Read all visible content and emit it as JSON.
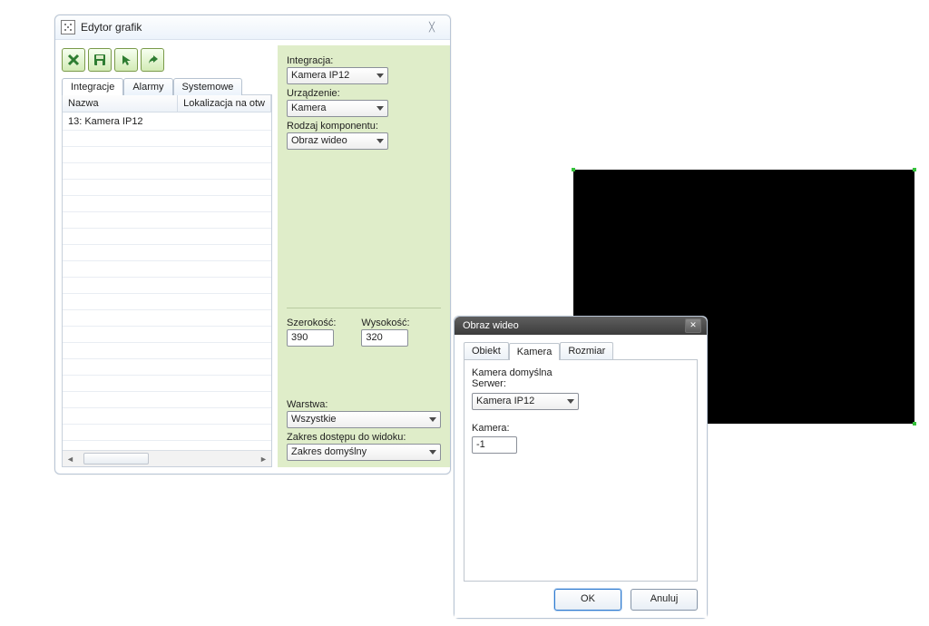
{
  "editor": {
    "title": "Edytor grafik",
    "toolbar": {
      "delete_tip": "X",
      "save_tip": "💾",
      "pointer_tip": "↖",
      "share_tip": "↪"
    },
    "tabs": [
      "Integracje",
      "Alarmy",
      "Systemowe"
    ],
    "active_tab_index": 0,
    "table": {
      "headers": [
        "Nazwa",
        "Lokalizacja na otw"
      ],
      "rows": [
        {
          "name": "13: Kamera IP12",
          "loc": ""
        }
      ]
    },
    "props": {
      "integracja_label": "Integracja:",
      "integracja": "Kamera IP12",
      "urzadzenie_label": "Urządzenie:",
      "urzadzenie": "Kamera",
      "rodzaj_label": "Rodzaj komponentu:",
      "rodzaj": "Obraz wideo",
      "szer_label": "Szerokość:",
      "szer": "390",
      "wys_label": "Wysokość:",
      "wys": "320",
      "warstwa_label": "Warstwa:",
      "warstwa": "Wszystkie",
      "zakres_label": "Zakres dostępu do widoku:",
      "zakres": "Zakres domyślny"
    }
  },
  "dialog": {
    "title": "Obraz wideo",
    "tabs": [
      "Obiekt",
      "Kamera",
      "Rozmiar"
    ],
    "active_tab_index": 1,
    "kamera_domyslna_label": "Kamera domyślna",
    "serwer_label": "Serwer:",
    "serwer": "Kamera IP12",
    "kamera_label": "Kamera:",
    "kamera": "-1",
    "ok": "OK",
    "cancel": "Anuluj"
  }
}
